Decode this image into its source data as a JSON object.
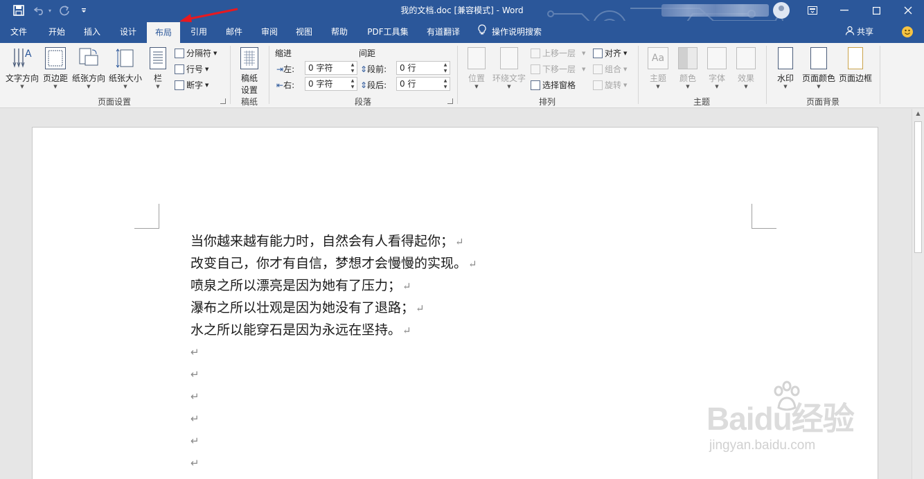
{
  "titlebar": {
    "title": "我的文档.doc [兼容模式] - Word",
    "quick_access": {
      "save_icon": "save-icon",
      "undo_icon": "undo-icon",
      "redo_icon": "redo-icon",
      "customize_icon": "customize-icon"
    },
    "window_controls": {
      "ribbon_display_icon": "ribbon-display-icon",
      "minimize_icon": "minimize-icon",
      "maximize_icon": "maximize-icon",
      "close_icon": "close-icon"
    }
  },
  "tabs": {
    "items": [
      "文件",
      "开始",
      "插入",
      "设计",
      "布局",
      "引用",
      "邮件",
      "审阅",
      "视图",
      "帮助",
      "PDF工具集",
      "有道翻译"
    ],
    "active": "布局",
    "tell_me": "操作说明搜索",
    "share": "共享"
  },
  "ribbon": {
    "page_setup": {
      "label": "页面设置",
      "text_direction": "文字方向",
      "margins": "页边距",
      "orientation": "纸张方向",
      "size": "纸张大小",
      "columns": "栏",
      "breaks": "分隔符",
      "line_numbers": "行号",
      "hyphenation": "断字"
    },
    "manuscript": {
      "label": "稿纸",
      "setup_line1": "稿纸",
      "setup_line2": "设置"
    },
    "paragraph": {
      "label": "段落",
      "indent_label": "缩进",
      "spacing_label": "间距",
      "left_label": "左:",
      "right_label": "右:",
      "before_label": "段前:",
      "after_label": "段后:",
      "left_value": "0 字符",
      "right_value": "0 字符",
      "before_value": "0 行",
      "after_value": "0 行"
    },
    "arrange": {
      "label": "排列",
      "position": "位置",
      "wrap_text": "环绕文字",
      "bring_forward": "上移一层",
      "send_backward": "下移一层",
      "selection_pane": "选择窗格",
      "align": "对齐",
      "group": "组合",
      "rotate": "旋转"
    },
    "themes": {
      "label": "主题",
      "themes": "主题",
      "colors": "颜色",
      "fonts": "字体",
      "effects": "效果"
    },
    "page_background": {
      "label": "页面背景",
      "watermark": "水印",
      "page_color": "页面颜色",
      "page_borders": "页面边框"
    }
  },
  "document": {
    "lines": [
      "当你越来越有能力时，自然会有人看得起你；",
      "改变自己，你才有自信，梦想才会慢慢的实现。",
      "喷泉之所以漂亮是因为她有了压力；",
      "瀑布之所以壮观是因为她没有了退路；",
      "水之所以能穿石是因为永远在坚持。"
    ],
    "paragraph_mark": "↵",
    "empty_paragraph_count": 6
  },
  "watermark": {
    "main": "Baidu经验",
    "sub": "jingyan.baidu.com"
  },
  "colors": {
    "accent": "#2b579a",
    "ribbon_bg": "#f3f3f3",
    "annotation_arrow": "#e8191f"
  }
}
